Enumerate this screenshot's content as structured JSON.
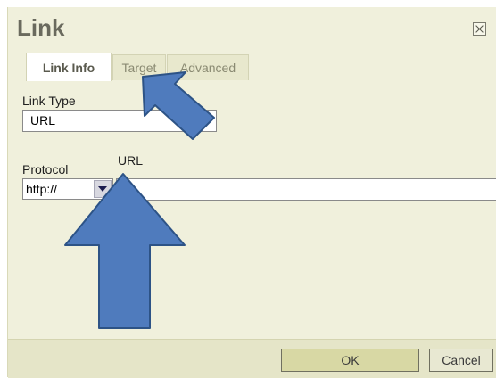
{
  "dialog": {
    "title": "Link",
    "tabs": [
      {
        "label": "Link Info",
        "active": true
      },
      {
        "label": "Target",
        "active": false
      },
      {
        "label": "Advanced",
        "active": false
      }
    ]
  },
  "form": {
    "link_type_label": "Link Type",
    "link_type_value": "URL",
    "protocol_label": "Protocol",
    "protocol_value": "http://",
    "url_label": "URL",
    "url_value": ""
  },
  "footer": {
    "ok_label": "OK",
    "cancel_label": "Cancel"
  },
  "colors": {
    "dialog_bg": "#f0f0dc",
    "arrow_fill": "#4f7bbd",
    "arrow_stroke": "#2d5386"
  }
}
